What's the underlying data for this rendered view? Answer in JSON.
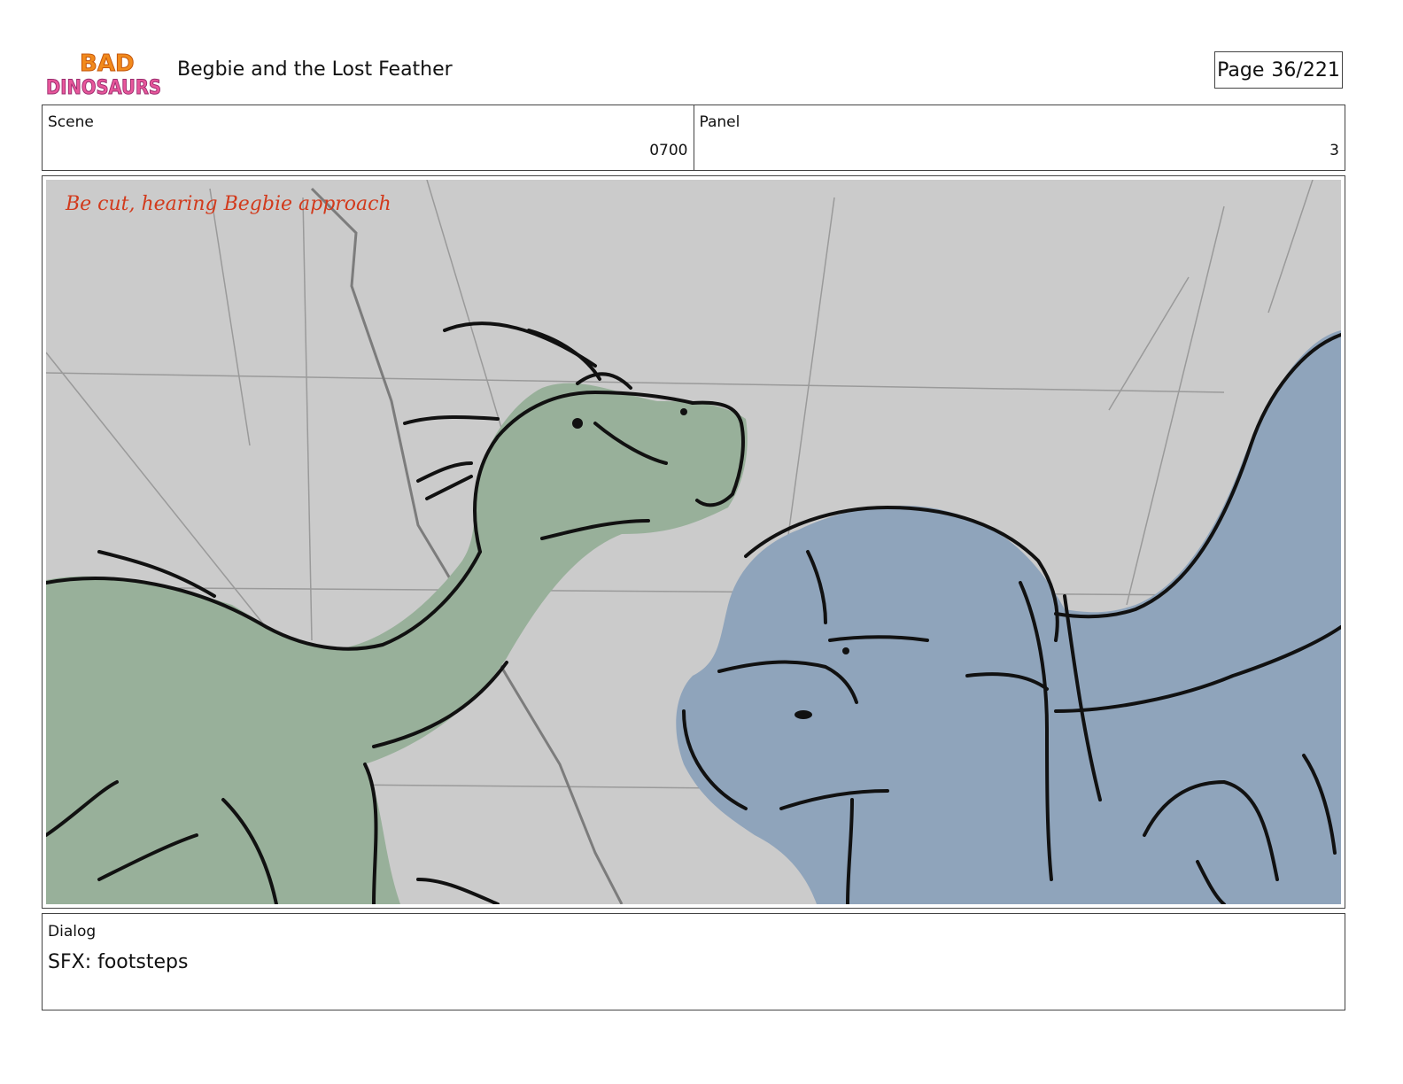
{
  "header": {
    "logo": {
      "line1": "BAD",
      "line2": "DINOSAURS"
    },
    "title": "Begbie and the Lost Feather",
    "page_label": "Page",
    "page_value": "36/221"
  },
  "info": {
    "scene_label": "Scene",
    "scene_value": "0700",
    "panel_label": "Panel",
    "panel_value": "3"
  },
  "panel": {
    "handwritten_note": "Be cut, hearing Begbie approach"
  },
  "dialog": {
    "label": "Dialog",
    "text": "SFX: footsteps"
  },
  "colors": {
    "background_gray": "#cbcbcb",
    "green_dino": "#98b09a",
    "blue_dino": "#8fa4bb",
    "note_red": "#d23a1c"
  }
}
